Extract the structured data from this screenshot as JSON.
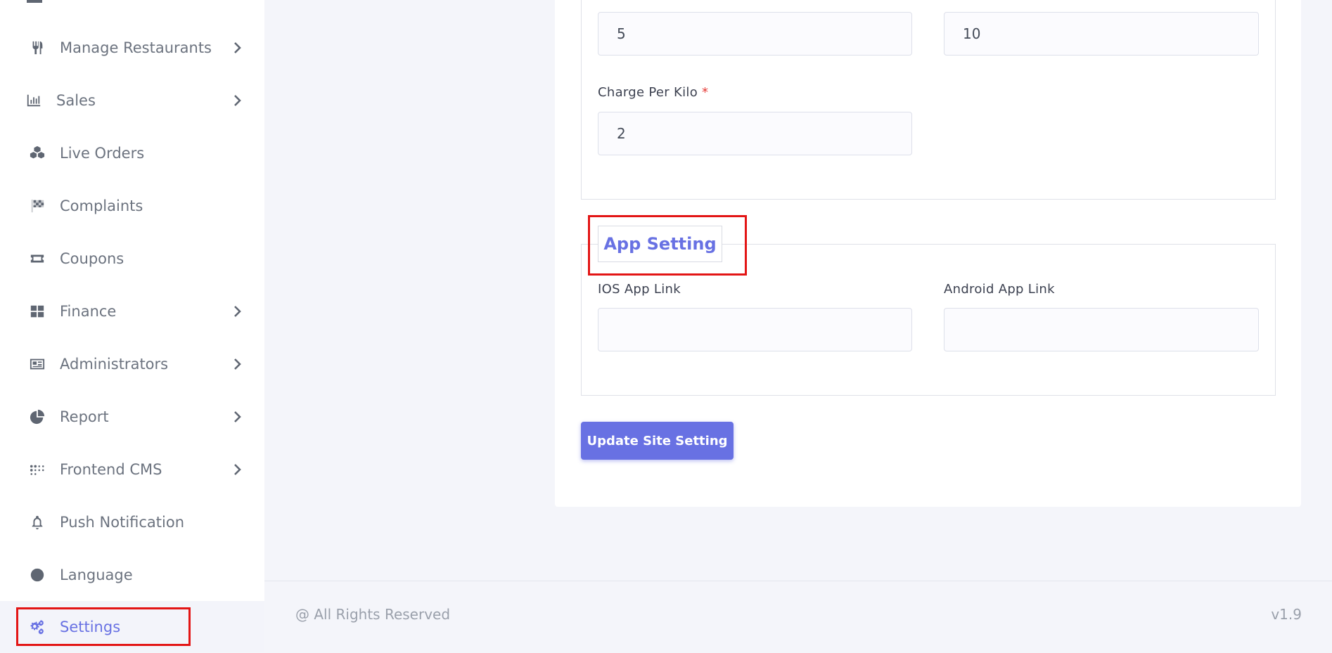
{
  "sidebar": {
    "items": [
      {
        "label": "Manage Restaurants",
        "icon": "utensils-icon",
        "has_submenu": true
      },
      {
        "label": "Sales",
        "icon": "bar-chart-icon",
        "has_submenu": true
      },
      {
        "label": "Live Orders",
        "icon": "cubes-icon",
        "has_submenu": false
      },
      {
        "label": "Complaints",
        "icon": "checkered-flag-icon",
        "has_submenu": false
      },
      {
        "label": "Coupons",
        "icon": "ticket-icon",
        "has_submenu": false
      },
      {
        "label": "Finance",
        "icon": "grid-icon",
        "has_submenu": true
      },
      {
        "label": "Administrators",
        "icon": "id-card-icon",
        "has_submenu": true
      },
      {
        "label": "Report",
        "icon": "pie-chart-icon",
        "has_submenu": true
      },
      {
        "label": "Frontend CMS",
        "icon": "dots-grid-icon",
        "has_submenu": true
      },
      {
        "label": "Push Notification",
        "icon": "bell-icon",
        "has_submenu": false
      },
      {
        "label": "Language",
        "icon": "globe-icon",
        "has_submenu": false
      },
      {
        "label": "Settings",
        "icon": "gears-icon",
        "has_submenu": false,
        "active": true
      }
    ]
  },
  "delivery": {
    "field_1_value": "5",
    "field_2_value": "10",
    "charge_per_kilo_label": "Charge Per Kilo",
    "required_mark": "*",
    "charge_per_kilo_value": "2"
  },
  "app_setting": {
    "legend": "App Setting",
    "ios_label": "IOS App Link",
    "ios_value": "",
    "android_label": "Android App Link",
    "android_value": ""
  },
  "actions": {
    "update_label": "Update Site Setting"
  },
  "footer": {
    "copyright": "@ All Rights Reserved",
    "version": "v1.9"
  },
  "colors": {
    "accent": "#6871e3",
    "highlight": "#e31515",
    "required": "#e53935"
  }
}
